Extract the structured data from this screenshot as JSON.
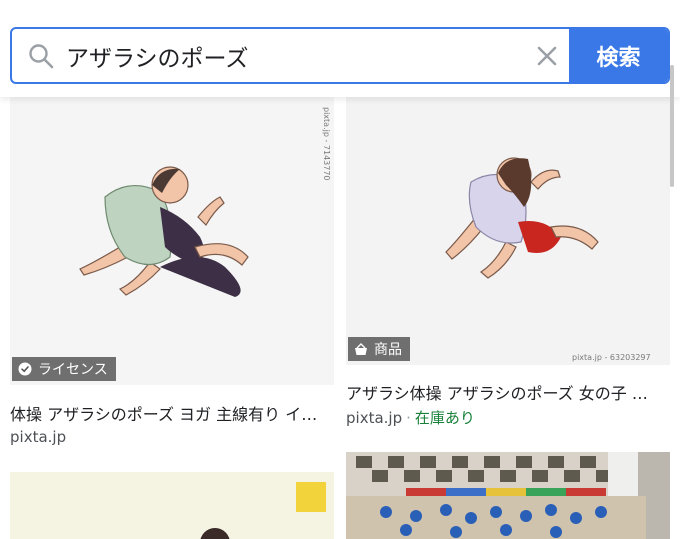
{
  "search": {
    "query": "アザラシのポーズ",
    "button_label": "検索"
  },
  "results": [
    {
      "badge": "ライセンス",
      "title": "体操 アザラシのポーズ ヨガ 主線有り イ…",
      "source": "pixta.jp",
      "watermark": "pixta.jp - 7143770"
    },
    {
      "badge": "商品",
      "title": "アザラシ体操 アザラシのポーズ 女の子 …",
      "source": "pixta.jp",
      "stock": "在庫あり",
      "watermark": "pixta.jp - 63203297"
    }
  ],
  "colors": {
    "accent": "#3b78e7",
    "stock_green": "#188038",
    "badge_bg": "#3c3c3c"
  },
  "icons": [
    "search-icon",
    "clear-icon",
    "check-circle-icon",
    "shopping-basket-icon"
  ]
}
